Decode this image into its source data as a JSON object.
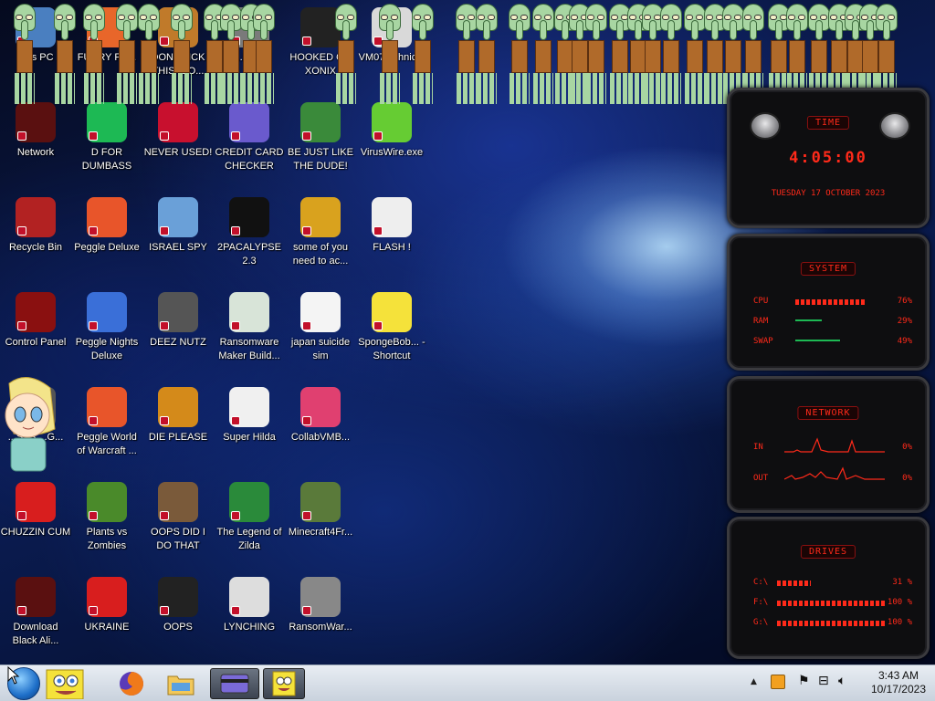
{
  "desktop": {
    "icons": [
      {
        "label": "This PC",
        "glyph": "pc-icon",
        "color": "#4a7fc0"
      },
      {
        "label": "FURRY FU...",
        "glyph": "firefox-icon",
        "color": "#e8662a"
      },
      {
        "label": "DONT TICK THIS ICO...",
        "glyph": "shortcut-icon",
        "color": "#c07a2a"
      },
      {
        "label": "S...D ... R",
        "glyph": "shortcut-icon",
        "color": "#7a7a7a"
      },
      {
        "label": "HOOKED ON XONIX",
        "glyph": "xonix-icon",
        "color": "#222222"
      },
      {
        "label": "VM07...chnic...",
        "glyph": "file-icon",
        "color": "#d9d9d9"
      },
      {
        "label": "Network",
        "glyph": "alien-icon",
        "color": "#5a1010"
      },
      {
        "label": "D FOR DUMBASS",
        "glyph": "chat-icon",
        "color": "#1db954"
      },
      {
        "label": "NEVER USED!",
        "glyph": "devcpp-icon",
        "color": "#c8102e"
      },
      {
        "label": "CREDIT CARD CHECKER",
        "glyph": "credit-card-icon",
        "color": "#6a5acd"
      },
      {
        "label": "BE JUST LIKE THE DUDE!",
        "glyph": "santa-icon",
        "color": "#3a8a3a"
      },
      {
        "label": "VirusWire.exe",
        "glyph": "lime-icon",
        "color": "#66cc33"
      },
      {
        "label": "Recycle Bin",
        "glyph": "recycle-bin-icon",
        "color": "#b22222"
      },
      {
        "label": "Peggle Deluxe",
        "glyph": "peggle-icon",
        "color": "#e8552a"
      },
      {
        "label": "ISRAEL SPY",
        "glyph": "network-icon",
        "color": "#6aa0d8"
      },
      {
        "label": "2PACALYPSE 2.3",
        "glyph": "terminal-icon",
        "color": "#111111"
      },
      {
        "label": "some of you need to ac...",
        "glyph": "dog-icon",
        "color": "#d9a21e"
      },
      {
        "label": "FLASH !",
        "glyph": "doc-icon",
        "color": "#eeeeee"
      },
      {
        "label": "Control Panel",
        "glyph": "control-panel-icon",
        "color": "#8a1010"
      },
      {
        "label": "Peggle Nights Deluxe",
        "glyph": "peggle-icon",
        "color": "#3a6fd8"
      },
      {
        "label": "DEEZ NUTZ",
        "glyph": "stack-icon",
        "color": "#555555"
      },
      {
        "label": "Ransomware Maker Build...",
        "glyph": "window-icon",
        "color": "#d8e4d8"
      },
      {
        "label": "japan suicide sim",
        "glyph": "doc-icon",
        "color": "#f4f4f4"
      },
      {
        "label": "SpongeBob... - Shortcut",
        "glyph": "spongebob-icon",
        "color": "#f5e23a"
      },
      {
        "label": "...STS ...G...",
        "glyph": "shortcut-icon",
        "color": "#555555"
      },
      {
        "label": "Peggle World of Warcraft ...",
        "glyph": "peggle-icon",
        "color": "#e8552a"
      },
      {
        "label": "DIE PLEASE",
        "glyph": "de-icon",
        "color": "#d48a1a"
      },
      {
        "label": "Super Hilda",
        "glyph": "pixel-icon",
        "color": "#f0f0f0"
      },
      {
        "label": "CollabVMB...",
        "glyph": "monitor-icon",
        "color": "#e04070"
      },
      {
        "label": "CHUZZIN CUM",
        "glyph": "chuzzle-icon",
        "color": "#d81e1e"
      },
      {
        "label": "Plants vs Zombies",
        "glyph": "flower-icon",
        "color": "#4a8a2a"
      },
      {
        "label": "OOPS DID I DO THAT",
        "glyph": "portrait-icon",
        "color": "#7a5a3a"
      },
      {
        "label": "The Legend of Zilda",
        "glyph": "zilda-icon",
        "color": "#2a8a3a"
      },
      {
        "label": "Minecraft4Fr...",
        "glyph": "minecraft-icon",
        "color": "#5a7a3a"
      },
      {
        "label": "Download Black Ali...",
        "glyph": "alien-icon",
        "color": "#5a1010"
      },
      {
        "label": "UKRAINE",
        "glyph": "radiation-icon",
        "color": "#d81e1e"
      },
      {
        "label": "OOPS",
        "glyph": "skull-icon",
        "color": "#222222"
      },
      {
        "label": "LYNCHING",
        "glyph": "noose-icon",
        "color": "#dddddd"
      },
      {
        "label": "RansomWar...",
        "glyph": "skull-icon",
        "color": "#888888"
      }
    ]
  },
  "widgets": {
    "time": {
      "title": "TIME",
      "clock": "4:05:00",
      "date": "TUESDAY 17 OCTOBER 2023"
    },
    "system": {
      "title": "SYSTEM",
      "rows": [
        {
          "name": "CPU",
          "value": "76%",
          "level": 0.76
        },
        {
          "name": "RAM",
          "value": "29%",
          "level": 0.29
        },
        {
          "name": "SWAP",
          "value": "49%",
          "level": 0.49
        }
      ]
    },
    "network": {
      "title": "NETWORK",
      "rows": [
        {
          "name": "IN",
          "value": "0%"
        },
        {
          "name": "OUT",
          "value": "0%"
        }
      ]
    },
    "drives": {
      "title": "DRIVES",
      "rows": [
        {
          "name": "C:\\",
          "value": "31 %",
          "level": 0.31
        },
        {
          "name": "F:\\",
          "value": "100 %",
          "level": 1.0
        },
        {
          "name": "G:\\",
          "value": "100 %",
          "level": 1.0
        }
      ]
    }
  },
  "taskbar": {
    "buttons": [
      {
        "name": "spongebob-launcher",
        "active": false
      },
      {
        "name": "firefox",
        "active": false
      },
      {
        "name": "file-explorer",
        "active": false
      },
      {
        "name": "credit-card-checker",
        "active": true
      },
      {
        "name": "spongebob-window",
        "active": true
      }
    ],
    "clock_time": "3:43 AM",
    "clock_date": "10/17/2023"
  },
  "colors": {
    "widget_accent": "#ff2a1a",
    "taskbar_bg": "#dfe5ec"
  }
}
